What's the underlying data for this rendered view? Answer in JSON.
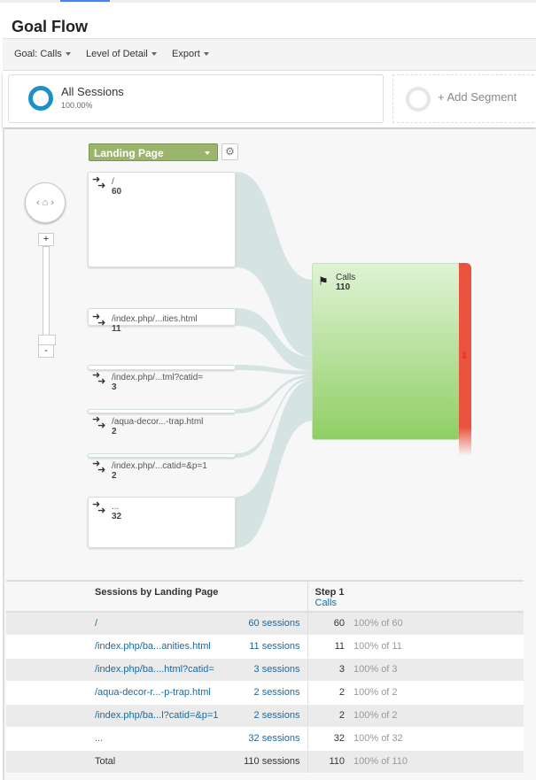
{
  "page": {
    "title": "Goal Flow"
  },
  "toolbar": {
    "goal": "Goal: Calls",
    "detail": "Level of Detail",
    "export": "Export"
  },
  "segments": {
    "name": "All Sessions",
    "pct": "100.00%",
    "add": "+ Add Segment",
    "color": "#1e90c8"
  },
  "flow": {
    "dimension": "Landing Page",
    "nodes": [
      {
        "label": "/",
        "value": 60
      },
      {
        "label": "/index.php/...ities.html",
        "value": 11
      },
      {
        "label": "/index.php/...tml?catid=",
        "value": 3
      },
      {
        "label": "/aqua-decor...-trap.html",
        "value": 2
      },
      {
        "label": "/index.php/...catid=&p=1",
        "value": 2
      },
      {
        "label": "...",
        "value": 32
      }
    ],
    "goal": {
      "label": "Calls",
      "value": 110,
      "color": "#90cf65",
      "exit_color": "#ea533d"
    },
    "flow_color": "#d6e3e3"
  },
  "table": {
    "headers": {
      "landing": "Sessions by Landing Page",
      "step": "Step 1",
      "step_goal": "Calls"
    },
    "rows": [
      {
        "page": "/",
        "sessions": "60 sessions",
        "count": "60",
        "pct": "100% of 60"
      },
      {
        "page": "/index.php/ba...anities.html",
        "sessions": "11 sessions",
        "count": "11",
        "pct": "100% of 11"
      },
      {
        "page": "/index.php/ba....html?catid=",
        "sessions": "3 sessions",
        "count": "3",
        "pct": "100% of 3"
      },
      {
        "page": "/aqua-decor-r...-p-trap.html",
        "sessions": "2 sessions",
        "count": "2",
        "pct": "100% of 2"
      },
      {
        "page": "/index.php/ba...l?catid=&p=1",
        "sessions": "2 sessions",
        "count": "2",
        "pct": "100% of 2"
      },
      {
        "page": "...",
        "sessions": "32 sessions",
        "count": "32",
        "pct": "100% of 32"
      }
    ],
    "total": {
      "page": "Total",
      "sessions": "110 sessions",
      "count": "110",
      "pct": "100% of 110"
    }
  }
}
